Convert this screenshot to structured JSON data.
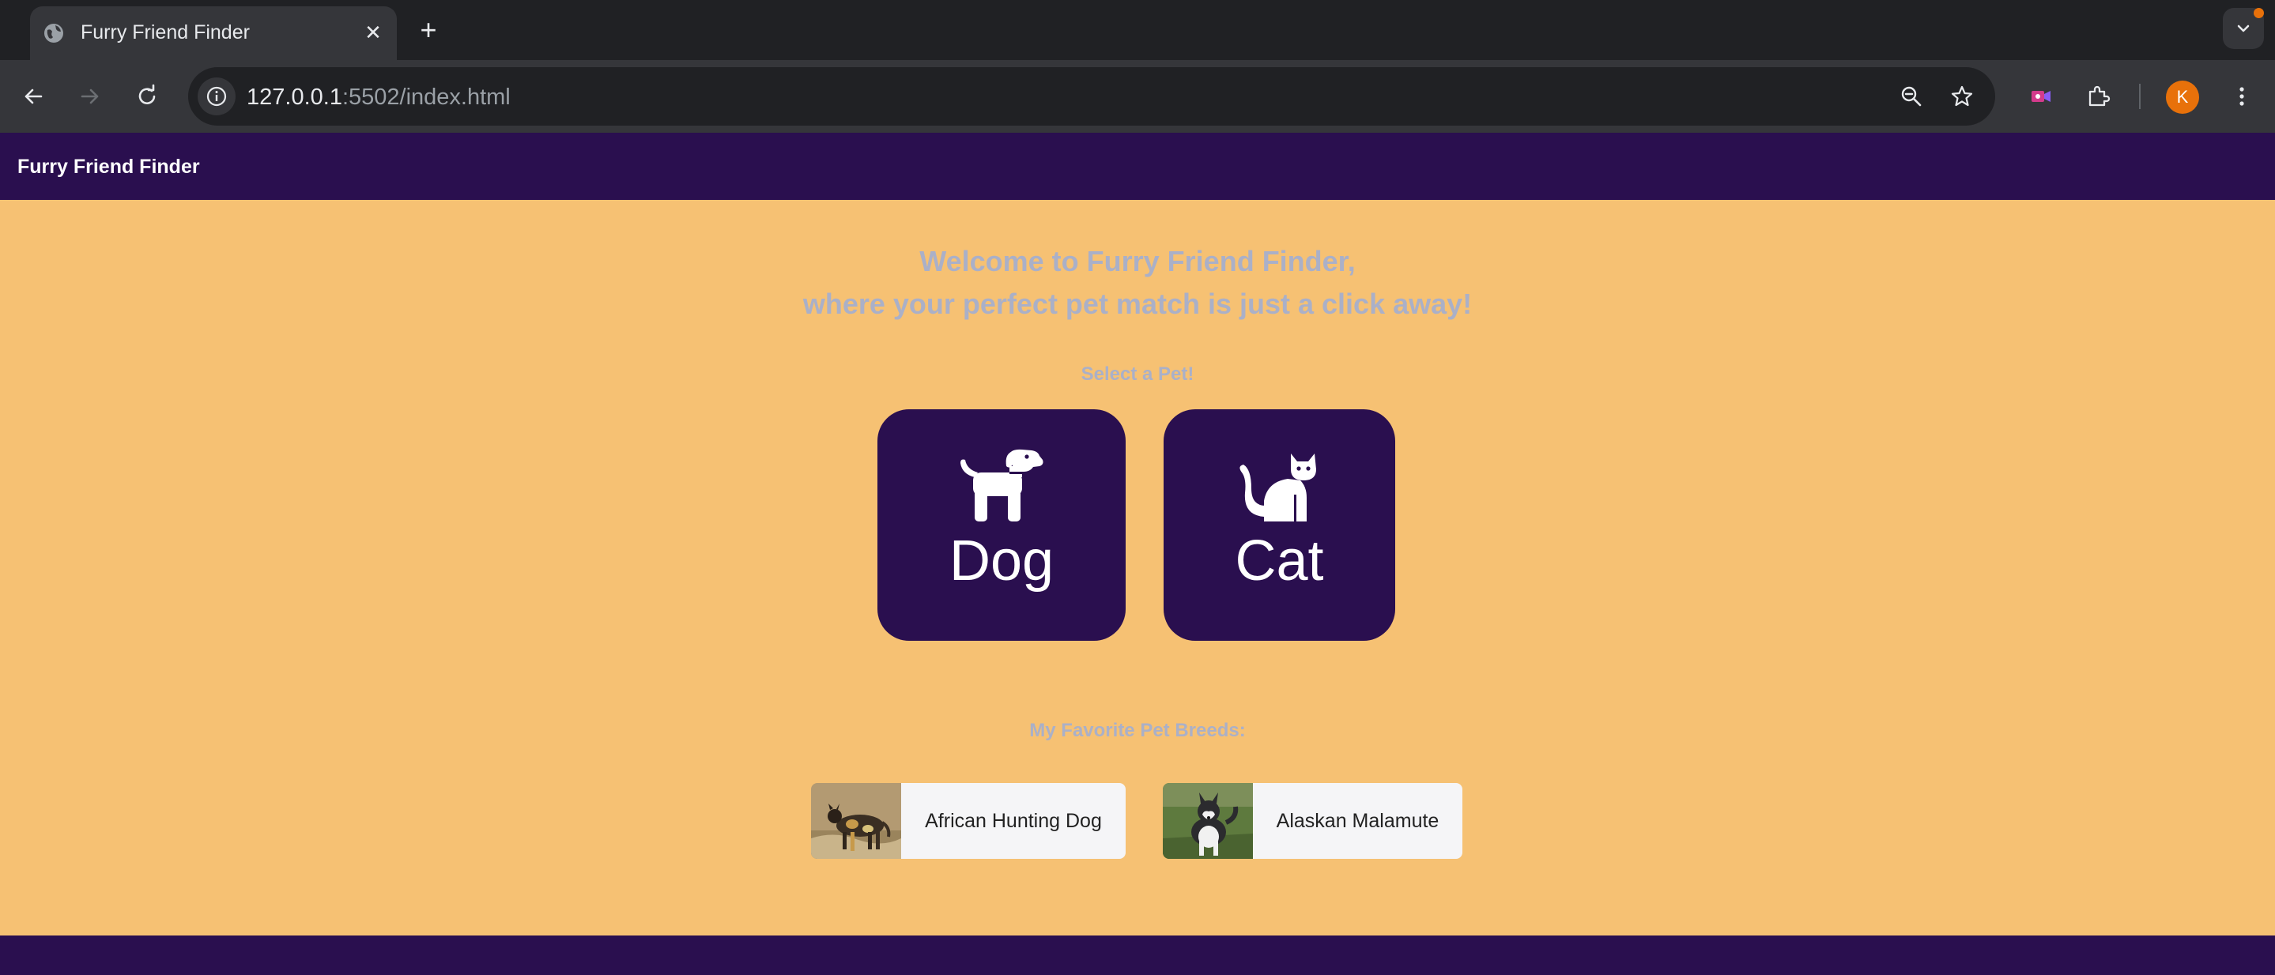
{
  "browser": {
    "tab_title": "Furry Friend Finder",
    "url_host": "127.0.0.1",
    "url_rest": ":5502/index.html",
    "profile_initial": "K"
  },
  "site": {
    "brand": "Furry Friend Finder",
    "welcome_line1": "Welcome to Furry Friend Finder,",
    "welcome_line2": "where your perfect pet match is just a click away!",
    "select_label": "Select a Pet!",
    "pets": [
      {
        "label": "Dog",
        "icon": "dog-icon"
      },
      {
        "label": "Cat",
        "icon": "cat-icon"
      }
    ],
    "favorites_label": "My Favorite Pet Breeds:",
    "breeds": [
      {
        "name": "African Hunting Dog"
      },
      {
        "name": "Alaskan Malamute"
      }
    ]
  },
  "colors": {
    "navbar": "#2a0f4f",
    "page_bg": "#f6c173",
    "heading_text": "#aab0c8",
    "card_bg": "#2a0f4f"
  }
}
